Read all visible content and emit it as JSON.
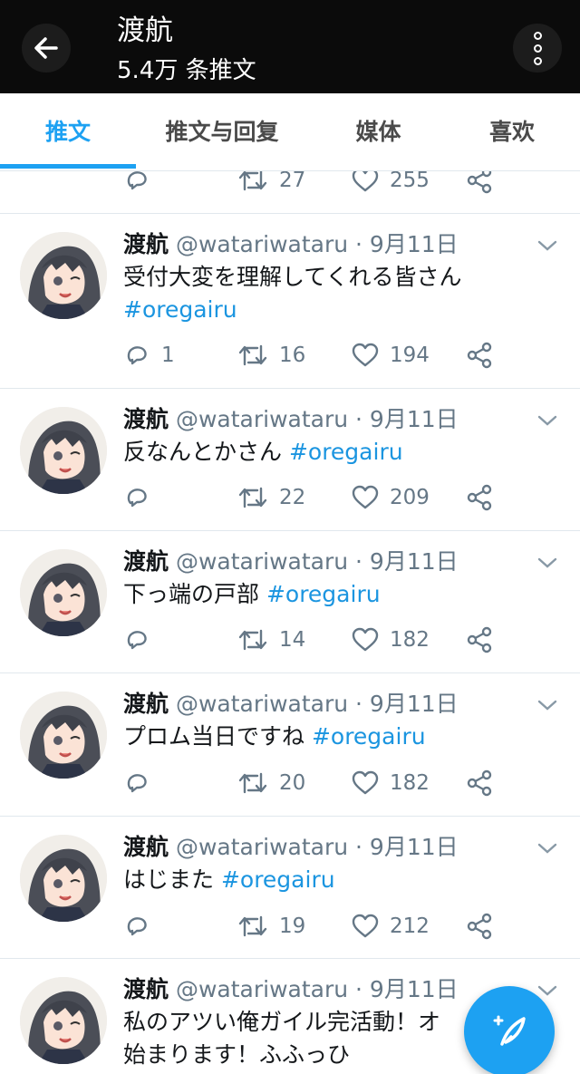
{
  "header": {
    "title": "渡航",
    "subtitle": "5.4万 条推文",
    "back_icon": "arrow-left-icon",
    "more_icon": "more-vertical-icon"
  },
  "tabs": [
    {
      "label": "推文",
      "active": true
    },
    {
      "label": "推文与回复",
      "active": false
    },
    {
      "label": "媒体",
      "active": false
    },
    {
      "label": "喜欢",
      "active": false
    }
  ],
  "partial_tweet": {
    "retweets": "27",
    "likes": "255"
  },
  "tweets": [
    {
      "name": "渡航",
      "handle": "@watariwataru · 9月11日",
      "text": "受付大変を理解してくれる皆さん",
      "tag": "#oregairu",
      "replies": "1",
      "retweets": "16",
      "likes": "194"
    },
    {
      "name": "渡航",
      "handle": "@watariwataru · 9月11日",
      "text": "反なんとかさん ",
      "tag": "#oregairu",
      "replies": "",
      "retweets": "22",
      "likes": "209"
    },
    {
      "name": "渡航",
      "handle": "@watariwataru · 9月11日",
      "text": "下っ端の戸部 ",
      "tag": "#oregairu",
      "replies": "",
      "retweets": "14",
      "likes": "182"
    },
    {
      "name": "渡航",
      "handle": "@watariwataru · 9月11日",
      "text": "プロム当日ですね ",
      "tag": "#oregairu",
      "replies": "",
      "retweets": "20",
      "likes": "182"
    },
    {
      "name": "渡航",
      "handle": "@watariwataru · 9月11日",
      "text": "はじまた ",
      "tag": "#oregairu",
      "replies": "",
      "retweets": "19",
      "likes": "212"
    },
    {
      "name": "渡航",
      "handle": "@watariwataru · 9月11日",
      "text": "私のアツい俺ガイル完活動！オ",
      "text2": "始まります！ふふっひ"
    }
  ],
  "fab": {
    "icon": "compose-feather-icon"
  },
  "colors": {
    "accent": "#1da1f2",
    "hashtag": "#1b95e0",
    "muted": "#657786",
    "header_bg": "#0b0b0b"
  }
}
